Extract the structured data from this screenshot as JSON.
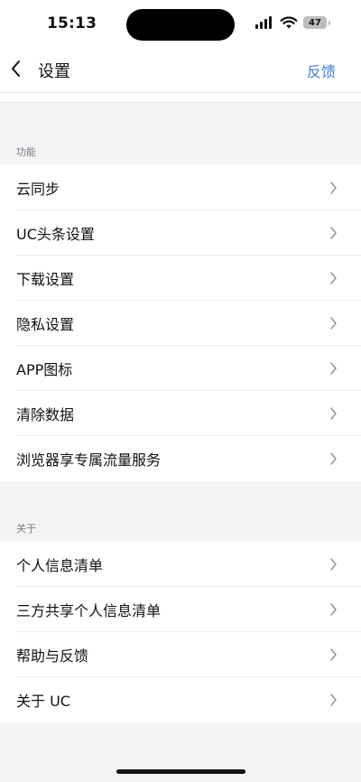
{
  "status": {
    "time": "15:13",
    "battery": "47"
  },
  "nav": {
    "title": "设置",
    "action": "反馈"
  },
  "sections": [
    {
      "title": "功能",
      "items": [
        {
          "label": "云同步"
        },
        {
          "label": "UC头条设置"
        },
        {
          "label": "下载设置"
        },
        {
          "label": "隐私设置"
        },
        {
          "label": "APP图标"
        },
        {
          "label": "清除数据"
        },
        {
          "label": "浏览器享专属流量服务"
        }
      ]
    },
    {
      "title": "关于",
      "items": [
        {
          "label": "个人信息清单"
        },
        {
          "label": "三方共享个人信息清单"
        },
        {
          "label": "帮助与反馈"
        },
        {
          "label": "关于 UC"
        }
      ]
    }
  ],
  "colors": {
    "accent": "#3f7fd0",
    "background": "#f4f4f6",
    "row": "#ffffff",
    "section_title": "#7a7a80"
  },
  "icons": {
    "back": "chevron-left-icon",
    "row": "chevron-right-icon",
    "signal": "cellular-signal-icon",
    "wifi": "wifi-icon",
    "battery": "battery-icon"
  }
}
